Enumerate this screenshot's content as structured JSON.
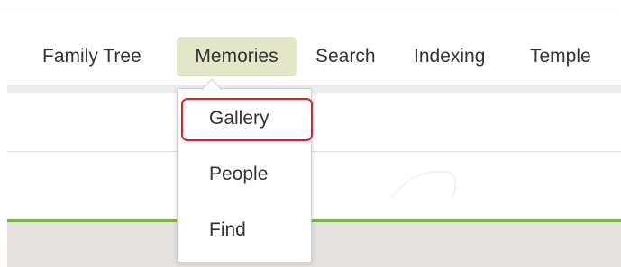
{
  "nav": {
    "items": [
      {
        "label": "Family Tree"
      },
      {
        "label": "Memories"
      },
      {
        "label": "Search"
      },
      {
        "label": "Indexing"
      },
      {
        "label": "Temple"
      }
    ],
    "active_item": "Memories"
  },
  "dropdown": {
    "items": [
      {
        "label": "Gallery"
      },
      {
        "label": "People"
      },
      {
        "label": "Find"
      }
    ],
    "highlighted_item": "Gallery"
  },
  "colors": {
    "active_tab_bg": "#e3e6c9",
    "green_rule": "#7db247",
    "highlight_outline": "#e0202a",
    "footer_gray": "#e6e3e0"
  }
}
